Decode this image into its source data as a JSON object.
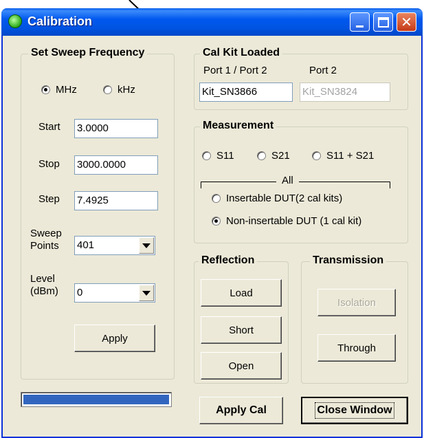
{
  "window": {
    "title": "Calibration"
  },
  "sweep": {
    "legend": "Set Sweep Frequency",
    "units": [
      {
        "label": "MHz",
        "selected": true
      },
      {
        "label": "kHz",
        "selected": false
      }
    ],
    "start": {
      "label": "Start",
      "value": "3.0000"
    },
    "stop": {
      "label": "Stop",
      "value": "3000.0000"
    },
    "step": {
      "label": "Step",
      "value": "7.4925"
    },
    "points": {
      "label_line1": "Sweep",
      "label_line2": "Points",
      "value": "401"
    },
    "level": {
      "label_line1": "Level",
      "label_line2": "(dBm)",
      "value": "0"
    },
    "apply_label": "Apply"
  },
  "calkit": {
    "legend": "Cal Kit Loaded",
    "port1_label": "Port 1 / Port 2",
    "port2_label": "Port 2",
    "port1_value": "Kit_SN3866",
    "port2_value": "Kit_SN3824"
  },
  "measurement": {
    "legend": "Measurement",
    "options": [
      {
        "label": "S11",
        "selected": false
      },
      {
        "label": "S21",
        "selected": false
      },
      {
        "label": "S11 + S21",
        "selected": false
      }
    ],
    "all_label": "All",
    "dut_options": [
      {
        "label": "Insertable DUT(2 cal kits)",
        "selected": false
      },
      {
        "label": "Non-insertable DUT (1 cal kit)",
        "selected": true
      }
    ]
  },
  "reflection": {
    "legend": "Reflection",
    "load": "Load",
    "short": "Short",
    "open": "Open"
  },
  "transmission": {
    "legend": "Transmission",
    "isolation": "Isolation",
    "through": "Through"
  },
  "progress": {
    "value": 1.0,
    "color": "#3266be"
  },
  "apply_cal_label": "Apply Cal",
  "close_label": "Close Window"
}
